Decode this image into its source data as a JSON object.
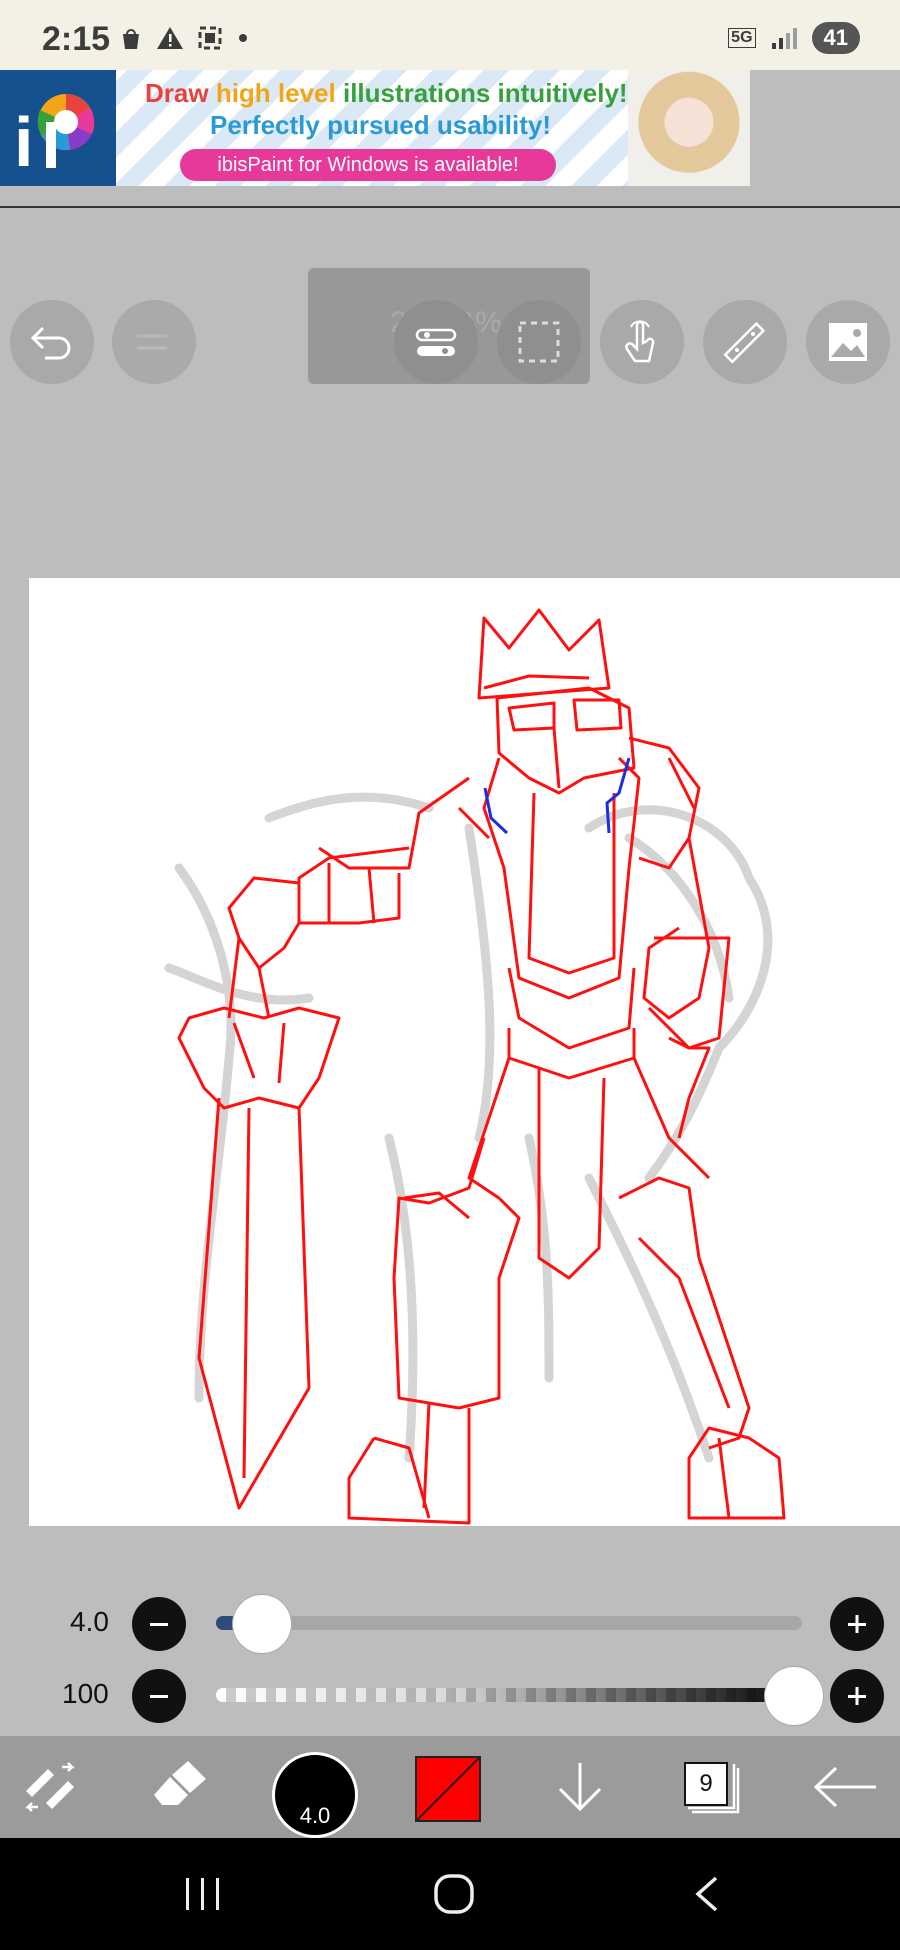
{
  "status_bar": {
    "time": "2:15",
    "network": "5G",
    "battery": "41"
  },
  "ad": {
    "line1_part1": "Draw ",
    "line1_part2": "high level ",
    "line1_part3": "illustrations ",
    "line1_part4": "intuitively!",
    "line2": "Perfectly pursued usability!",
    "cta": "ibisPaint for Windows is available!"
  },
  "toolbar": {
    "zoom_level": "271.8%"
  },
  "brush": {
    "size_value": "4.0",
    "opacity_value": "100",
    "size_fraction": 0.06,
    "opacity_fraction": 1.0
  },
  "bottom_bar": {
    "brush_size_label": "4.0",
    "layers_count": "9",
    "color": "#ff0000"
  }
}
